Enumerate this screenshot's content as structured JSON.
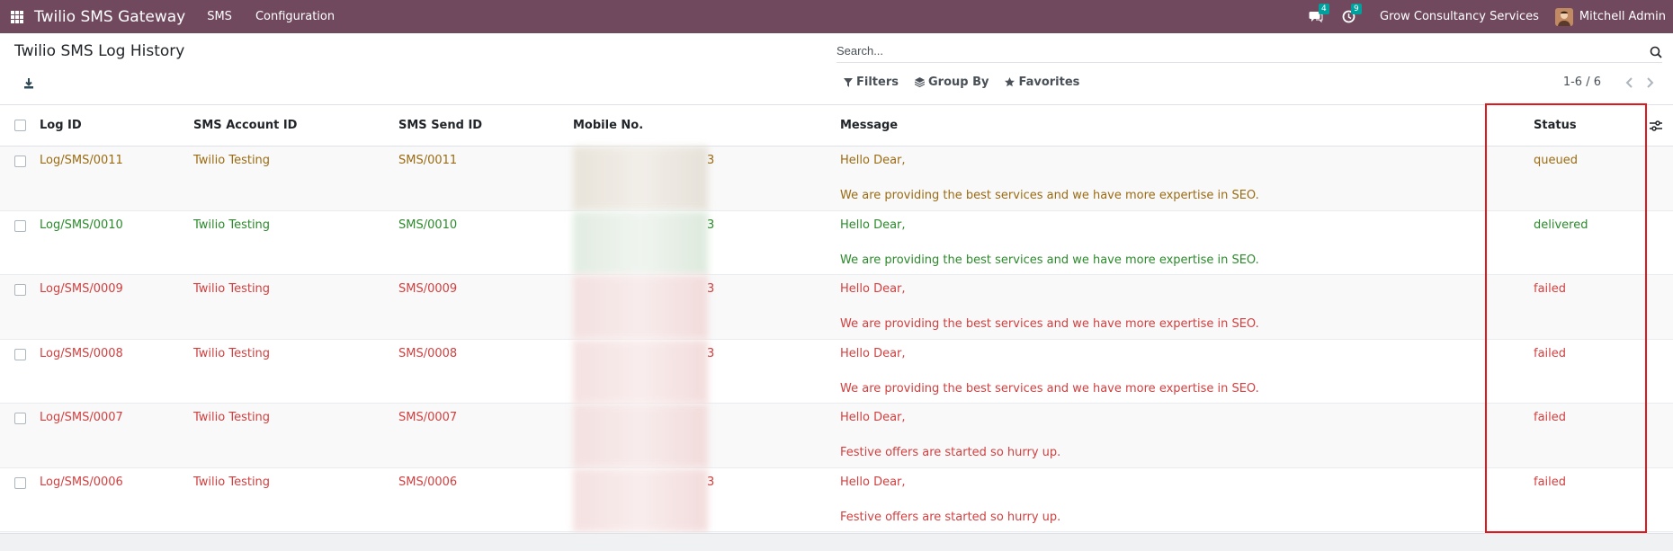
{
  "navbar": {
    "app_title": "Twilio SMS Gateway",
    "menus": [
      "SMS",
      "Configuration"
    ],
    "messages_badge": "4",
    "activities_badge": "9",
    "company": "Grow Consultancy Services",
    "user": "Mitchell Admin"
  },
  "control": {
    "title": "Twilio SMS Log History",
    "search_placeholder": "Search...",
    "filters_label": "Filters",
    "groupby_label": "Group By",
    "favorites_label": "Favorites",
    "pager": "1-6 / 6"
  },
  "table": {
    "columns": [
      "Log ID",
      "SMS Account ID",
      "SMS Send ID",
      "Mobile No.",
      "Message",
      "Status"
    ],
    "rows": [
      {
        "log_id": "Log/SMS/0011",
        "account": "Twilio Testing",
        "send_id": "SMS/0011",
        "mobile_tail": "3",
        "msg1": "Hello Dear,",
        "msg2": "We are providing the best services and we have more expertise in SEO.",
        "status": "queued"
      },
      {
        "log_id": "Log/SMS/0010",
        "account": "Twilio Testing",
        "send_id": "SMS/0010",
        "mobile_tail": "3",
        "msg1": "Hello Dear,",
        "msg2": "We are providing the best services and we have more expertise in SEO.",
        "status": "delivered"
      },
      {
        "log_id": "Log/SMS/0009",
        "account": "Twilio Testing",
        "send_id": "SMS/0009",
        "mobile_tail": "3",
        "msg1": "Hello Dear,",
        "msg2": "We are providing the best services and we have more expertise in SEO.",
        "status": "failed"
      },
      {
        "log_id": "Log/SMS/0008",
        "account": "Twilio Testing",
        "send_id": "SMS/0008",
        "mobile_tail": "3",
        "msg1": "Hello Dear,",
        "msg2": "We are providing the best services and we have more expertise in SEO.",
        "status": "failed"
      },
      {
        "log_id": "Log/SMS/0007",
        "account": "Twilio Testing",
        "send_id": "SMS/0007",
        "mobile_tail": "",
        "msg1": "Hello Dear,",
        "msg2": "Festive offers are started so hurry up.",
        "status": "failed"
      },
      {
        "log_id": "Log/SMS/0006",
        "account": "Twilio Testing",
        "send_id": "SMS/0006",
        "mobile_tail": "3",
        "msg1": "Hello Dear,",
        "msg2": "Festive offers are started so hurry up.",
        "status": "failed"
      }
    ]
  },
  "colors": {
    "navbar": "#71495f",
    "queued": "#9b6b12",
    "delivered": "#2b8a2b",
    "failed": "#d23f3f",
    "highlight": "#e0171c"
  }
}
